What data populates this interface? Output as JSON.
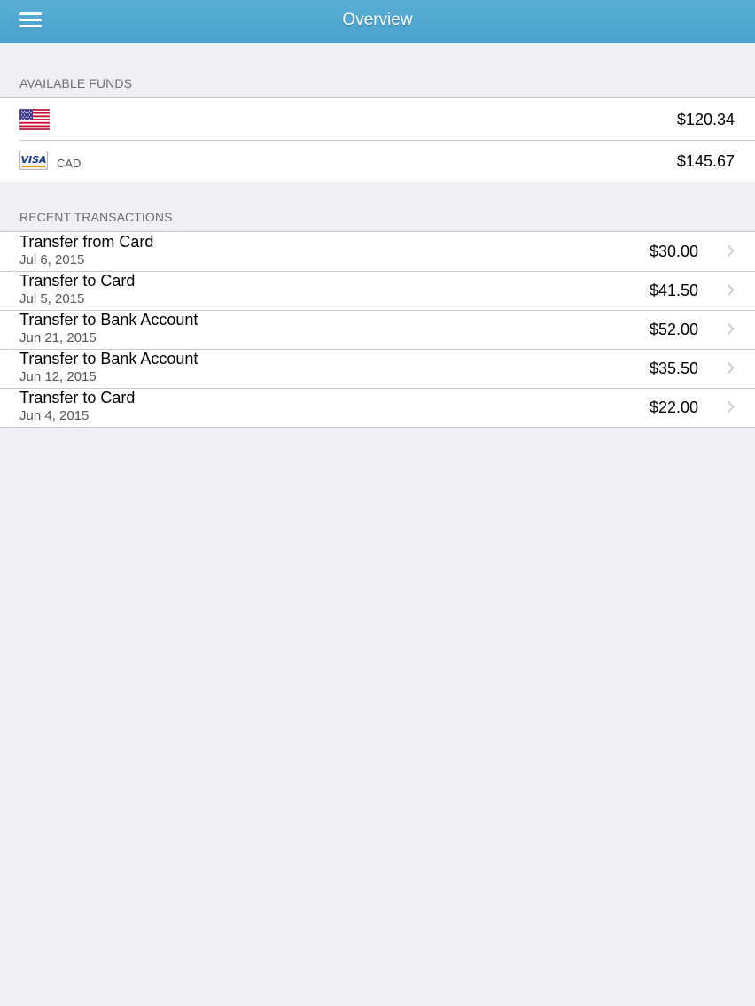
{
  "navbar": {
    "title": "Overview",
    "menu_icon": "hamburger-menu-icon"
  },
  "available_funds": {
    "header": "AVAILABLE FUNDS",
    "rows": [
      {
        "icon": "us-flag-icon",
        "currency": "",
        "amount": "$120.34"
      },
      {
        "icon": "visa-card-icon",
        "currency": "CAD",
        "amount": "$145.67"
      }
    ]
  },
  "recent_transactions": {
    "header": "RECENT TRANSACTIONS",
    "rows": [
      {
        "title": "Transfer from Card",
        "date": "Jul 6, 2015",
        "amount": "$30.00"
      },
      {
        "title": "Transfer to Card",
        "date": "Jul 5, 2015",
        "amount": "$41.50"
      },
      {
        "title": "Transfer to Bank Account",
        "date": "Jun 21, 2015",
        "amount": "$52.00"
      },
      {
        "title": "Transfer to Bank Account",
        "date": "Jun 12, 2015",
        "amount": "$35.50"
      },
      {
        "title": "Transfer to Card",
        "date": "Jun 4, 2015",
        "amount": "$22.00"
      }
    ]
  },
  "colors": {
    "navbar": "#4ea5d0",
    "background": "#efeff4",
    "separator": "#c8c7cc",
    "chevron": "#c7c7cc"
  }
}
